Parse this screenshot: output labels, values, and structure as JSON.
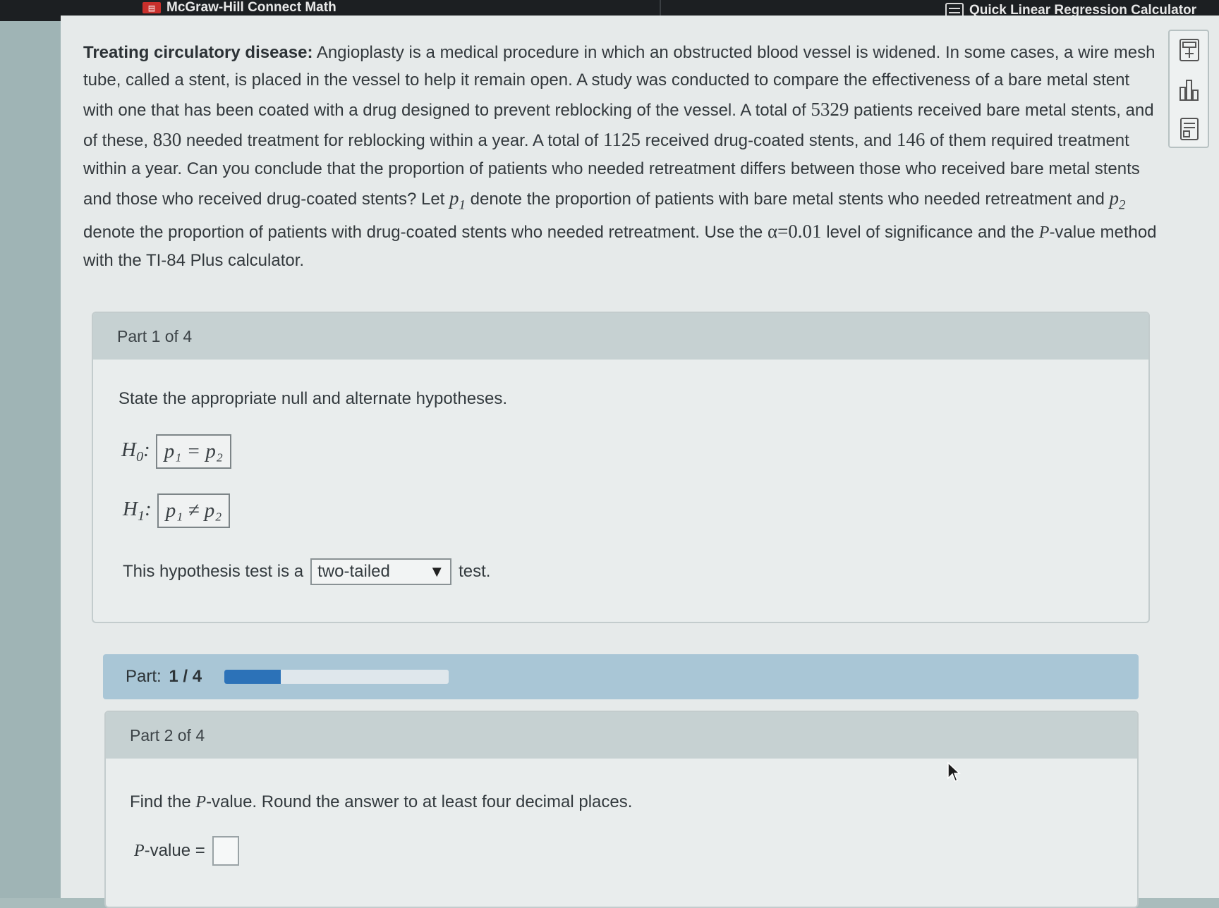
{
  "topbar": {
    "app_title": "McGraw-Hill Connect Math",
    "calculator_link": "Quick Linear Regression Calculator"
  },
  "problem": {
    "bold_lead": "Treating circulatory disease:",
    "t1": " Angioplasty is a medical procedure in which an obstructed blood vessel is widened. In some cases, a wire mesh tube, called a stent, is placed in the vessel to help it remain open. A study was conducted to compare the effectiveness of a bare metal stent with one that has been coated with a drug designed to prevent reblocking of the vessel. A total of ",
    "n1": "5329",
    "t2": " patients received bare metal stents, and of these, ",
    "x1": "830",
    "t3": " needed treatment for reblocking within a year. A total of ",
    "n2": "1125",
    "t4": " received drug-coated stents, and ",
    "x2": "146",
    "t5": " of them required treatment within a year. Can you conclude that the proportion of patients who needed retreatment differs between those who received bare metal stents and those who received drug-coated stents? Let ",
    "t6": " denote the proportion of patients with bare metal stents who needed retreatment and ",
    "t7": " denote the proportion of patients with drug-coated stents who needed retreatment. Use the ",
    "alpha": "α=0.01",
    "t8": " level of significance and the ",
    "pword": "P",
    "t9": "-value method with the TI-84 Plus calculator.",
    "p1_symbol": "p",
    "p1_sub": "1",
    "p2_symbol": "p",
    "p2_sub": "2"
  },
  "tools": [
    "calculator-icon",
    "bar-chart-icon",
    "data-table-icon"
  ],
  "part1": {
    "header": "Part 1 of 4",
    "prompt": "State the appropriate null and alternate hypotheses.",
    "h0_label": "H",
    "h0_sub": "0",
    "h0_value": "p₁ = p₂",
    "h1_label": "H",
    "h1_sub": "1",
    "h1_value": "p₁ ≠ p₂",
    "tail_prefix": "This hypothesis test is a",
    "tail_selected": "two-tailed",
    "tail_suffix": "test."
  },
  "progress": {
    "label": "Part:",
    "value": "1 / 4",
    "fraction": 0.25
  },
  "part2": {
    "header": "Part 2 of 4",
    "prompt_pre": "Find the ",
    "prompt_p": "P",
    "prompt_post": "-value. Round the answer to at least four decimal places.",
    "pvalue_p": "P",
    "pvalue_label": "-value =",
    "pvalue_input": ""
  }
}
